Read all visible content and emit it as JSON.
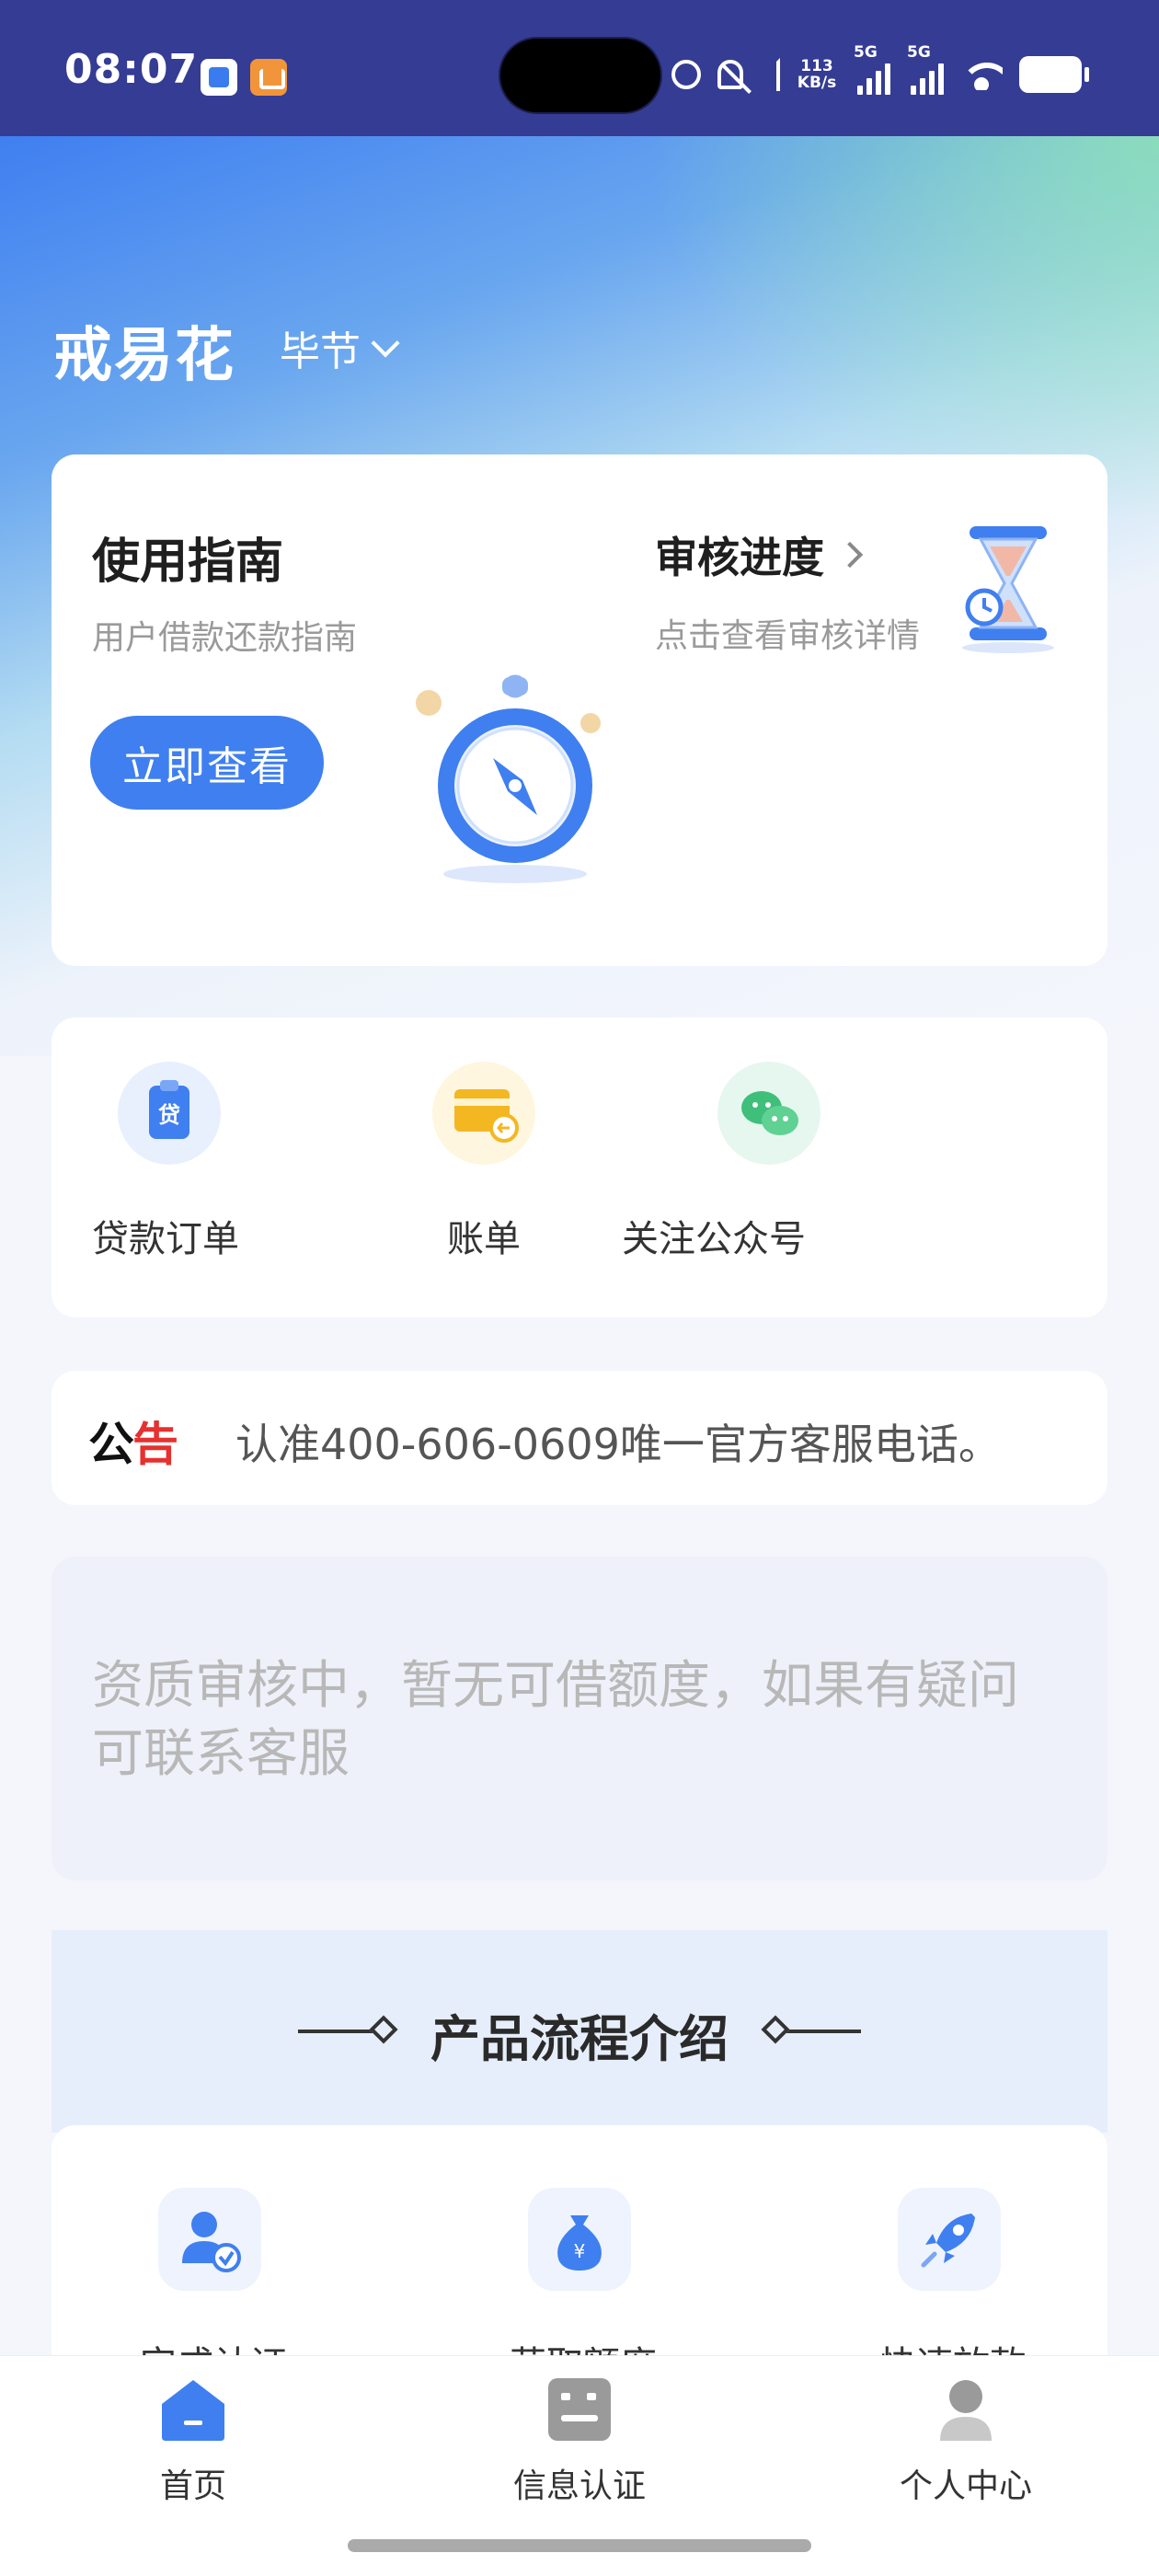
{
  "status_bar": {
    "time": "08:07",
    "net_speed_top": "113",
    "net_speed_bottom": "KB/s",
    "sim1": "5G",
    "sim2": "5G"
  },
  "header": {
    "brand": "戒易花",
    "city": "毕节"
  },
  "guide": {
    "title": "使用指南",
    "subtitle": "用户借款还款指南",
    "button": "立即查看",
    "progress_title": "审核进度",
    "progress_subtitle": "点击查看审核详情"
  },
  "menu": {
    "items": [
      {
        "label": "贷款订单",
        "icon": "loan-order-icon"
      },
      {
        "label": "账单",
        "icon": "bill-icon"
      },
      {
        "label": "关注公众号",
        "icon": "wechat-icon"
      }
    ]
  },
  "notice": {
    "tag_black": "公",
    "tag_red": "告",
    "text": "认准400-606-0609唯一官方客服电话。"
  },
  "status_message": "资质审核中，暂无可借额度，如果有疑问可联系客服",
  "process": {
    "title": "产品流程介绍",
    "steps": [
      {
        "label": "完成认证",
        "icon": "user-verify-icon"
      },
      {
        "label": "获取额度",
        "icon": "money-bag-icon"
      },
      {
        "label": "快速放款",
        "icon": "rocket-icon"
      }
    ]
  },
  "tabbar": {
    "items": [
      {
        "label": "首页",
        "icon": "home-icon",
        "active": true
      },
      {
        "label": "信息认证",
        "icon": "id-card-icon",
        "active": false
      },
      {
        "label": "个人中心",
        "icon": "person-icon",
        "active": false
      }
    ]
  },
  "colors": {
    "primary": "#3f7ff0",
    "status_bar": "#353c94",
    "notice_red": "#e5312f",
    "bill_yellow": "#f3b722",
    "wechat_green": "#3fbf7a"
  }
}
